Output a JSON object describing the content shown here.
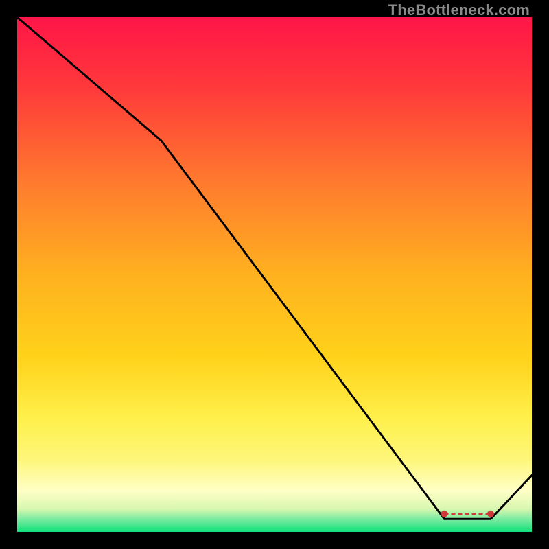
{
  "watermark": "TheBottleneck.com",
  "chart_data": {
    "type": "line",
    "title": "",
    "xlabel": "",
    "ylabel": "",
    "xlim": [
      0,
      100
    ],
    "ylim": [
      0,
      100
    ],
    "grid": false,
    "legend": false,
    "background_gradient": {
      "top_color": "#ff1548",
      "mid_colors": [
        "#ff7a2e",
        "#ffd21a",
        "#fdf67a",
        "#ffffc6"
      ],
      "bottom_color": "#11e07a"
    },
    "curve_color": "#000000",
    "marker_color": "#d03a3a",
    "marker_band_y": 3.5,
    "x": [
      0,
      28,
      83,
      92,
      100
    ],
    "y": [
      100,
      76,
      2.5,
      2.5,
      11
    ],
    "marker_x_range": [
      83,
      92
    ]
  }
}
